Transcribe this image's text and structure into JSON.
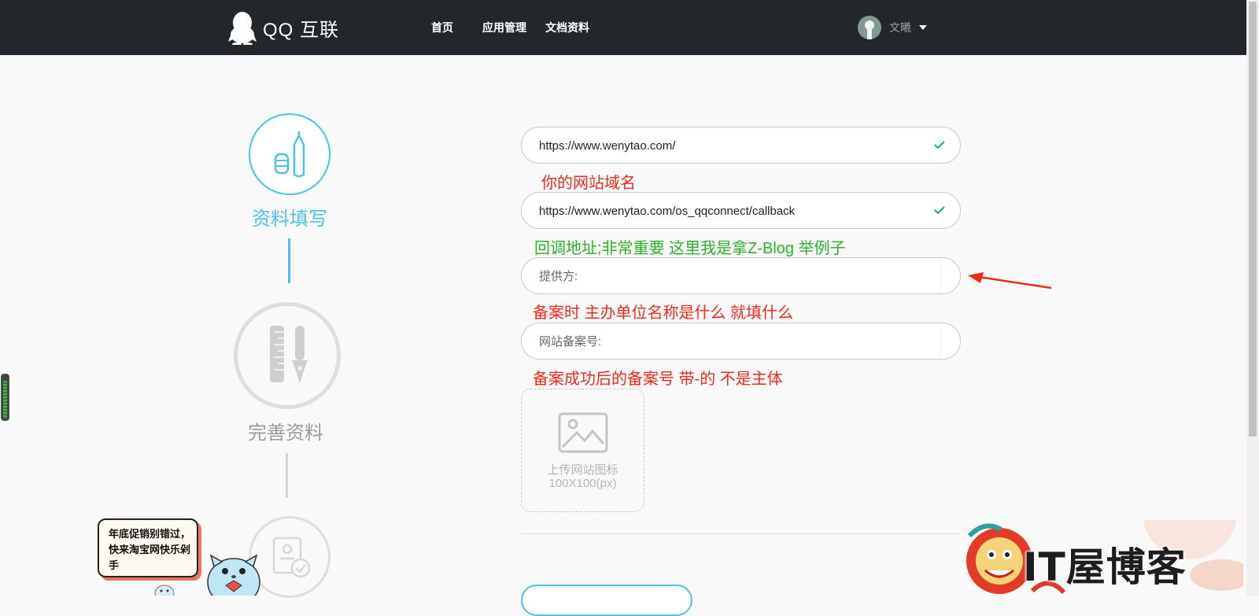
{
  "app": {
    "logo_text": "QQ 互联"
  },
  "nav": {
    "items": [
      {
        "label": "首页"
      },
      {
        "label": "应用管理"
      },
      {
        "label": "文档资料"
      }
    ],
    "user": {
      "name": "文曦"
    }
  },
  "steps": [
    {
      "label": "资料填写",
      "state": "active"
    },
    {
      "label": "完善资料",
      "state": "inactive"
    },
    {
      "label": "",
      "state": "inactive"
    }
  ],
  "form": {
    "website_url": {
      "value": "https://www.wenytao.com/",
      "valid": true
    },
    "callback_url": {
      "value": "https://www.wenytao.com/os_qqconnect/callback",
      "valid": true
    },
    "provider": {
      "placeholder": "提供方:",
      "value": ""
    },
    "icp_number": {
      "placeholder": "网站备案号:",
      "value": ""
    },
    "upload": {
      "line1": "上传网站图标",
      "line2": "100X100(px)"
    }
  },
  "annotations": {
    "domain_note": "你的网站域名",
    "callback_note": "回调地址;非常重要  这里我是拿Z-Blog 举例子",
    "provider_note": "备案时 主办单位名称是什么  就填什么",
    "icp_note": "备案成功后的备案号 带-的 不是主体"
  },
  "ads": {
    "promo_text": "年底促销别错过，快来淘宝网快乐剁手",
    "watermark_text": "IT屋博客"
  },
  "colors": {
    "accent": "#4cc3e5",
    "nav_bg": "#22272b",
    "annotation_red": "#ec2b1a",
    "annotation_green": "#28b327",
    "valid_check": "#1aad5a"
  }
}
